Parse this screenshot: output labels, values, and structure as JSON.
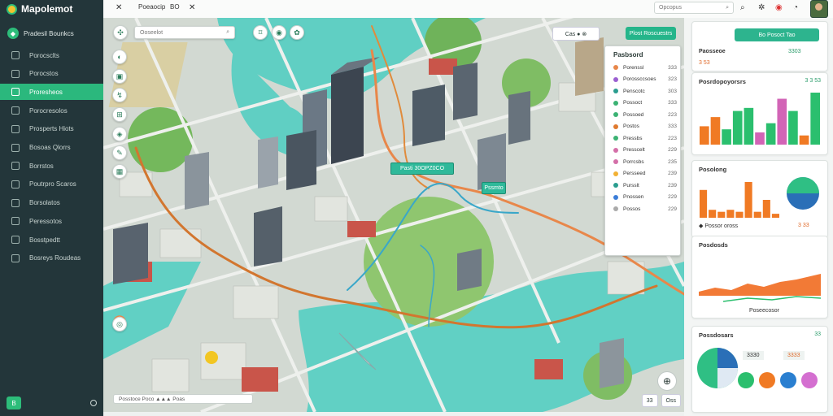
{
  "app": {
    "name": "Mapolemot",
    "workspace": "Pradesil Bounkcs"
  },
  "sidebar": {
    "items": [
      {
        "label": "Porocsclts",
        "icon": "dashboard-icon"
      },
      {
        "label": "Porocstos",
        "icon": "map-pin-icon"
      },
      {
        "label": "Proresheos",
        "icon": "route-icon",
        "active": true
      },
      {
        "label": "Porocresolos",
        "icon": "layers-icon"
      },
      {
        "label": "Prosperts Hiots",
        "icon": "chart-icon"
      },
      {
        "label": "Bosoas Qlorrs",
        "icon": "calendar-icon"
      },
      {
        "label": "Borrstos",
        "icon": "list-icon"
      },
      {
        "label": "Poutrpro Scaros",
        "icon": "tag-icon"
      },
      {
        "label": "Borsolatos",
        "icon": "filter-icon"
      },
      {
        "label": "Peressotos",
        "icon": "grid-icon"
      },
      {
        "label": "Bosstpedtt",
        "icon": "clock-icon"
      },
      {
        "label": "Bosreys Roudeas",
        "icon": "settings-icon"
      }
    ],
    "bottom_button": "B"
  },
  "topbar": {
    "tab1": "Poeaocip",
    "tab2": "BO",
    "search_placeholder": "Opcopus"
  },
  "map": {
    "search_placeholder": "Ooseelot",
    "chip": "Cas  ●  ⊗",
    "action_button": "Plost Roscuestrs",
    "legend": {
      "title": "Pasbsord",
      "items": [
        {
          "label": "Porenssl",
          "value": "333",
          "color": "#e8874a"
        },
        {
          "label": "Porossccsoes",
          "value": "323",
          "color": "#9b5fd1"
        },
        {
          "label": "Penscotc",
          "value": "303",
          "color": "#2a9d8f"
        },
        {
          "label": "Possoct",
          "value": "333",
          "color": "#3bb273"
        },
        {
          "label": "Possoed",
          "value": "223",
          "color": "#3bb273"
        },
        {
          "label": "Postos",
          "value": "333",
          "color": "#e07a2f"
        },
        {
          "label": "Pressbs",
          "value": "223",
          "color": "#3bb273"
        },
        {
          "label": "Presscelt",
          "value": "229",
          "color": "#d46fa8"
        },
        {
          "label": "Porrcsbs",
          "value": "235",
          "color": "#d46fa8"
        },
        {
          "label": "Persseed",
          "value": "239",
          "color": "#f2b134"
        },
        {
          "label": "Pursslt",
          "value": "239",
          "color": "#2a9d8f"
        },
        {
          "label": "Pnossen",
          "value": "229",
          "color": "#3b7dd8"
        },
        {
          "label": "Possos",
          "value": "229",
          "color": "#aaaaaa"
        }
      ]
    },
    "callouts": [
      "Pasti  30OPZ0CO",
      "Pssmto"
    ],
    "footer_left": "Posstoce  Poco  ▲▲▲  Poas",
    "footer_right": [
      "33",
      "Oss"
    ]
  },
  "panel": {
    "card1": {
      "button": "Bo Posoct Tao",
      "label": "Paosseoe",
      "value_left": "3 53",
      "value_right": "3303"
    },
    "card2": {
      "title": "Posrdopoyorsrs",
      "title_r": "3 3 53",
      "values": [
        12,
        18,
        10,
        22,
        24,
        8,
        14,
        30,
        22,
        6,
        34
      ]
    },
    "card3": {
      "title": "Posolong",
      "title_r": "",
      "values": [
        14,
        4,
        3,
        4,
        3,
        18,
        3,
        9,
        2
      ],
      "summary": "Possor oross",
      "summary_r": "3 33"
    },
    "card4": {
      "title": "Posdosds",
      "title_r": "",
      "footer": "Poseecosor"
    },
    "card5": {
      "title": "Possdosars",
      "title_r": "33",
      "v1": "3330",
      "v2": "3333"
    }
  },
  "colors": {
    "accent": "#2bb87d",
    "water": "#5fd0c5",
    "route": "#e8874a",
    "bar_orange": "#f07a24",
    "bar_green": "#2bbf6e",
    "bar_pink": "#d264b6"
  }
}
